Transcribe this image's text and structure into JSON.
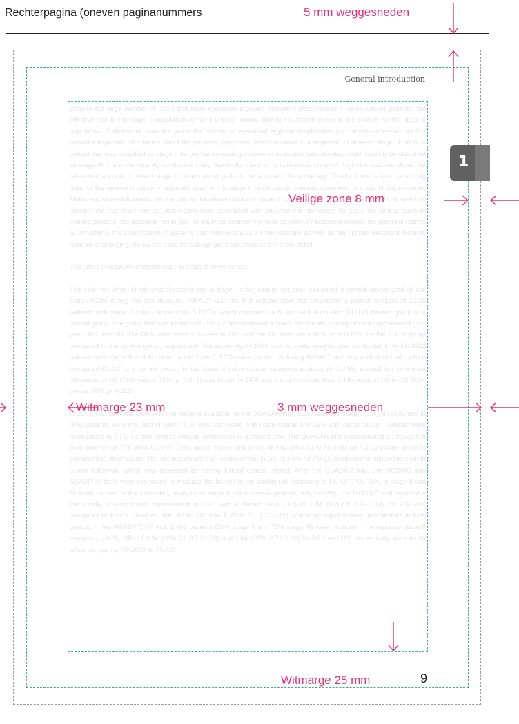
{
  "header": {
    "page_title": "Rechterpagina (oneven paginanummers",
    "bleed_label": "5 mm weggesneden"
  },
  "page": {
    "running_head": "General introduction",
    "chapter_number": "1",
    "page_number": "9"
  },
  "annotations": {
    "safe_zone": "Veilige zone 8 mm",
    "inner_margin": "Witmarge 23 mm",
    "trim_side": "3 mm weggesneden",
    "bottom_margin": "Witmarge 25 mm"
  },
  "body": {
    "paragraphs": [
      "Despite the large number of RCTs that have evaluated adjuvant treatment effectiveness in colon cancer patients, the effectiveness in the stage II population remains unclear, mainly due to insufficient power in the studies for the stage II population. Furthermore, over the years the number of examined regional lymphnodes per patients increased as this provides important information about the patients' prognosis, which resulted in a migration of disease stage. That is, a patient that was classified as stage II before the increasing number of evaluated lymphnodes, could possibly be classified as stage III in a more recently conducted study. Secondly, there is no consensus on which high-risk features should be taken into account to select stage II colon cancer patients for adjuvant chemotherapy. Thirdly, there is less convincing data for the optimal duration of adjuvant treatment in stage II colon cancer patients compared to stage III colon cancer. Moreover, when deliberating on the optimal treatment choice in stage II colon cancer, it is important to explicitly take into account the fact that there are also health risks associated with adjuvant chemotherapy. To guide the clinical decision making process, the potential health gain of adjuvant treatment should be carefully balanced against the potential harms. Summarizing, the identification of patients that require adjuvant chemotherapy as well as the optimal treatment duration remains challenging. Below the three knowledge gaps are discussed in more detail.",
      "The effect of adjuvant chemotherapy in stage II colon cancer",
      "The treatment effect of adjuvant chemotherapy in stage II colon cancer has been evaluated in several randomized clinical trials (RCTs) during the last decades. IMPACT was the first collaboration that conducted a pooled analysis of 1,016 patients with stage II colon cancer from 5 RCTs, which compared a fluorouracil-leucovorin (FU-LV) treated group to a control group. The group that was treated with FU-LV demonstrated a small, statistically non-significant improvement in 5-year DFS and OS. The DFS rates were 76% versus 73% and the OS rates were 82% versus 80% for the FU-LV group compared to the control group, respectively. Subsequently, in 2004 another meta-analysis was conducted in which 3302 patients with stage II and III colon cancer from 7 RCTs were pooled, including IMPACT and two additional trials, which compared FU-LV to a control group. In the stage II colon cancer subgroup analysis (n=1,440), a small but significant difference of 4% (76% versus 72%, p=0.049) was found for DFS and a small non-significant difference of 1% in OS (81% versus 80%, p=0.113).",
      "In 2007, results of the QUASAR trial became available. In the QUASAR trial, 3,239 resected stage I (1%), II (91%) and III (8%) patients were included of which 71% was diagnosed with colon cancer and 29% with rectal cancer. Patients were randomized to a FU-LV arm (with or without levamisole) or a control arm. The QUASAR trial demonstrated a relative risk of recurrence of 0.78 (95% CI, 0.67-0.91) and a relative risk of OS of 0.82 (95% CI, 0.70-0.95) for FU-LV treated patients compared to observation. The authors reported an improvement in OS of 3.6% for FU-LV compared to observation within 5-year follow-up, which was assessed as having limited clinical impact. After the QUASAR trial, the MOSAIC and NSABP-07 trials were conducted to evaluate the benefit of the addition of oxaliplatin to FU-LV (FOLFOX) in stage II and III colon cancer. In the secondary analysis of stage II colon cancer patients only (n=899), the MOSAIC trial reported a statistically non-significant improvement in DFS with a hazard ratio (HR) of 0.84 (95%CI: 0.62-1.14) for FOLFOX compared to FU-LV. However, the HR for OS was 1 (95% CI: 0.70-1.41), indicating equal survival probabilities in both groups. In the NSABP C-07 trial, 2,409 patients (29% stage II and 71% stage III) were included. In a separate stage II analysis (n=695), HRs of 0.94 (95% CI: 0.70-1.26) and 1.04 (95%: 0.72-1.50) for DFS and OS, respectively, were found when comparing FOLFOX to FU-LV."
    ]
  },
  "colors": {
    "annotation": "#e0317a",
    "bleed_line": "#9a9a9a",
    "safe_zone_line": "#2db38a",
    "text_area_line": "#37a9d6",
    "chapter_tab": "#616161"
  }
}
